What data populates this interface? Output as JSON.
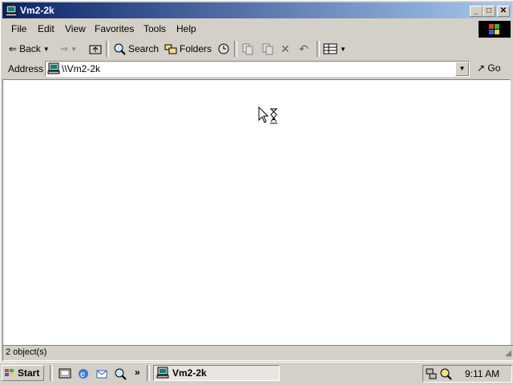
{
  "window": {
    "title": "Vm2-2k"
  },
  "menu": [
    "File",
    "Edit",
    "View",
    "Favorites",
    "Tools",
    "Help"
  ],
  "toolbar": {
    "back": "Back",
    "search": "Search",
    "folders": "Folders"
  },
  "address": {
    "label": "Address",
    "value": "\\\\Vm2-2k",
    "go": "Go"
  },
  "status": {
    "text": "2 object(s)"
  },
  "taskbar": {
    "start": "Start",
    "task": "Vm2-2k",
    "clock": "9:11 AM",
    "more": "»"
  }
}
